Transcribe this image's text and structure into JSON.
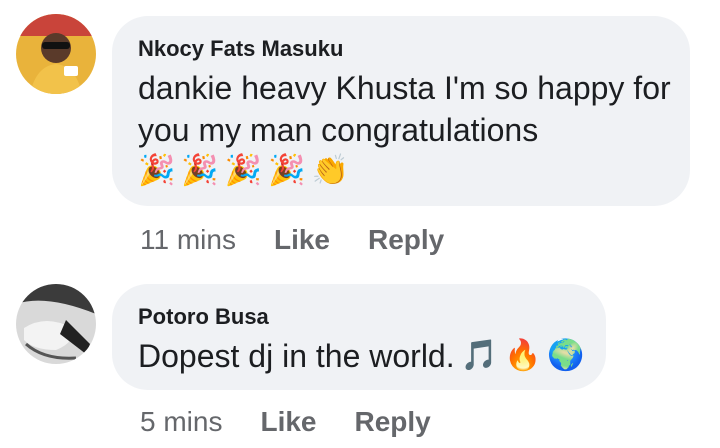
{
  "comments": [
    {
      "author": "Nkocy Fats Masuku",
      "text_line1": "dankie heavy Khusta I'm so happy for",
      "text_line2": "you my man congratulations",
      "emojis": [
        "🎉",
        "🎉",
        "🎉",
        "🎉",
        "👏"
      ],
      "time": "11 mins",
      "like_label": "Like",
      "reply_label": "Reply",
      "avatar_icon": "person-avatar-yellow"
    },
    {
      "author": "Potoro Busa",
      "text": "Dopest dj in the world.",
      "emojis": [
        "🎵",
        "🔥",
        "🌍"
      ],
      "time": "5 mins",
      "like_label": "Like",
      "reply_label": "Reply",
      "avatar_icon": "person-avatar-bw"
    }
  ]
}
